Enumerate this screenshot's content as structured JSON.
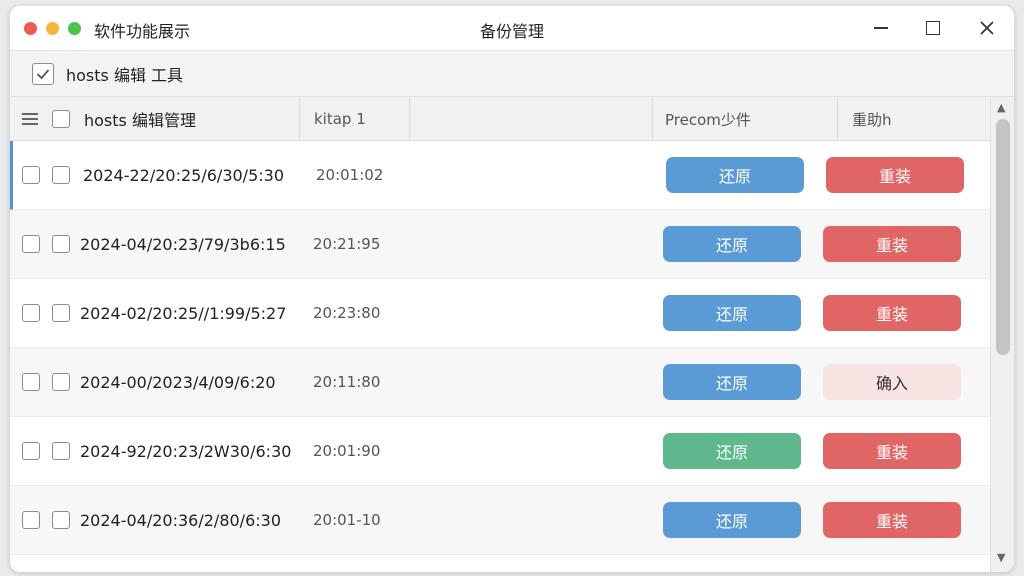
{
  "titlebar": {
    "app_name": "软件功能展示",
    "window_title": "备份管理"
  },
  "toolbar": {
    "label": "hosts 编辑 工具"
  },
  "table": {
    "headers": {
      "name": "hosts 编辑管理",
      "time": "kitap 1",
      "blank": "",
      "restore": "Precom少件",
      "action": "重助h"
    },
    "rows": [
      {
        "date": "2024-22/20:25/6/30/5:30",
        "time": "20:01:02",
        "restore_label": "还原",
        "action_label": "重装",
        "restore_color": "#5b9bd5",
        "action_color": "#e06666",
        "action_text_color": "#ffffff"
      },
      {
        "date": "2024-04/20:23/79/3b6:15",
        "time": "20:21:95",
        "restore_label": "还原",
        "action_label": "重装",
        "restore_color": "#5b9bd5",
        "action_color": "#e06666",
        "action_text_color": "#ffffff"
      },
      {
        "date": "2024-02/20:25//1:99/5:27",
        "time": "20:23:80",
        "restore_label": "还原",
        "action_label": "重装",
        "restore_color": "#5b9bd5",
        "action_color": "#e06666",
        "action_text_color": "#ffffff"
      },
      {
        "date": "2024-00/2023/4/09/6:20",
        "time": "20:11:80",
        "restore_label": "还原",
        "action_label": "确入",
        "restore_color": "#5b9bd5",
        "action_color": "#f6e3e2",
        "action_text_color": "#333333"
      },
      {
        "date": "2024-92/20:23/2W30/6:30",
        "time": "20:01:90",
        "restore_label": "还原",
        "action_label": "重装",
        "restore_color": "#5fb88d",
        "action_color": "#e06666",
        "action_text_color": "#ffffff"
      },
      {
        "date": "2024-04/20:36/2/80/6:30",
        "time": "20:01-10",
        "restore_label": "还原",
        "action_label": "重装",
        "restore_color": "#5b9bd5",
        "action_color": "#e06666",
        "action_text_color": "#ffffff"
      }
    ]
  },
  "colors": {
    "selected_accent": "#5b93cf"
  }
}
